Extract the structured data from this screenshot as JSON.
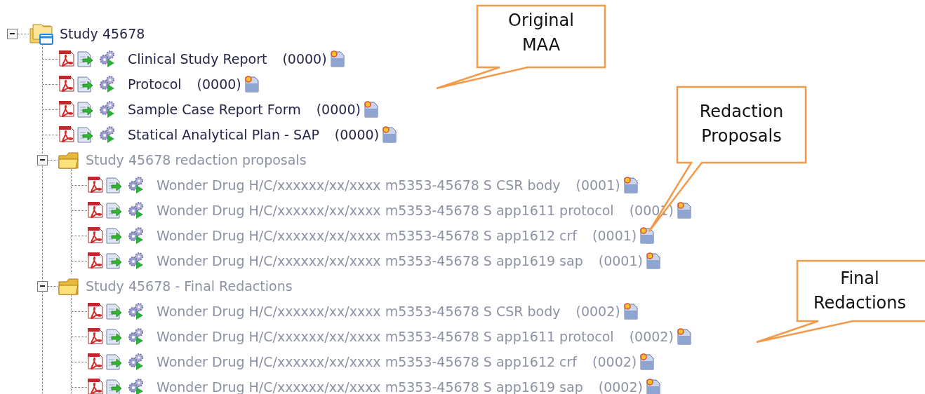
{
  "tree": {
    "label": "Study 45678",
    "kind": "study",
    "expanded": true,
    "dimmed": false,
    "children": [
      {
        "kind": "document",
        "label": "Clinical Study Report",
        "version": "(0000)",
        "dimmed": false
      },
      {
        "kind": "document",
        "label": "Protocol",
        "version": "(0000)",
        "dimmed": false
      },
      {
        "kind": "document",
        "label": "Sample Case Report Form",
        "version": "(0000)",
        "dimmed": false
      },
      {
        "kind": "document",
        "label": "Statical Analytical Plan - SAP",
        "version": "(0000)",
        "dimmed": false
      },
      {
        "kind": "folder",
        "label": "Study 45678 redaction proposals",
        "expanded": true,
        "dimmed": true,
        "children": [
          {
            "kind": "document",
            "label": "Wonder Drug H/C/xxxxxx/xx/xxxx m5353-45678 S CSR body",
            "version": "(0001)",
            "dimmed": true
          },
          {
            "kind": "document",
            "label": "Wonder Drug H/C/xxxxxx/xx/xxxx m5353-45678 S app1611 protocol",
            "version": "(0001)",
            "dimmed": true
          },
          {
            "kind": "document",
            "label": "Wonder Drug H/C/xxxxxx/xx/xxxx m5353-45678 S app1612 crf",
            "version": "(0001)",
            "dimmed": true
          },
          {
            "kind": "document",
            "label": "Wonder Drug H/C/xxxxxx/xx/xxxx m5353-45678 S app1619 sap",
            "version": "(0001)",
            "dimmed": true
          }
        ]
      },
      {
        "kind": "folder",
        "label": "Study 45678 - Final Redactions",
        "expanded": true,
        "dimmed": true,
        "children": [
          {
            "kind": "document",
            "label": "Wonder Drug H/C/xxxxxx/xx/xxxx m5353-45678 S CSR body",
            "version": "(0002)",
            "dimmed": true
          },
          {
            "kind": "document",
            "label": "Wonder Drug H/C/xxxxxx/xx/xxxx m5353-45678 S app1611 protocol",
            "version": "(0002)",
            "dimmed": true
          },
          {
            "kind": "document",
            "label": "Wonder Drug H/C/xxxxxx/xx/xxxx m5353-45678 S app1612 crf",
            "version": "(0002)",
            "dimmed": true
          },
          {
            "kind": "document",
            "label": "Wonder Drug H/C/xxxxxx/xx/xxxx m5353-45678 S app1619 sap",
            "version": "(0002)",
            "dimmed": true
          }
        ]
      }
    ]
  },
  "callouts": [
    {
      "text": "Original\nMAA"
    },
    {
      "text": "Redaction\nProposals"
    },
    {
      "text": "Final\nRedactions"
    }
  ]
}
